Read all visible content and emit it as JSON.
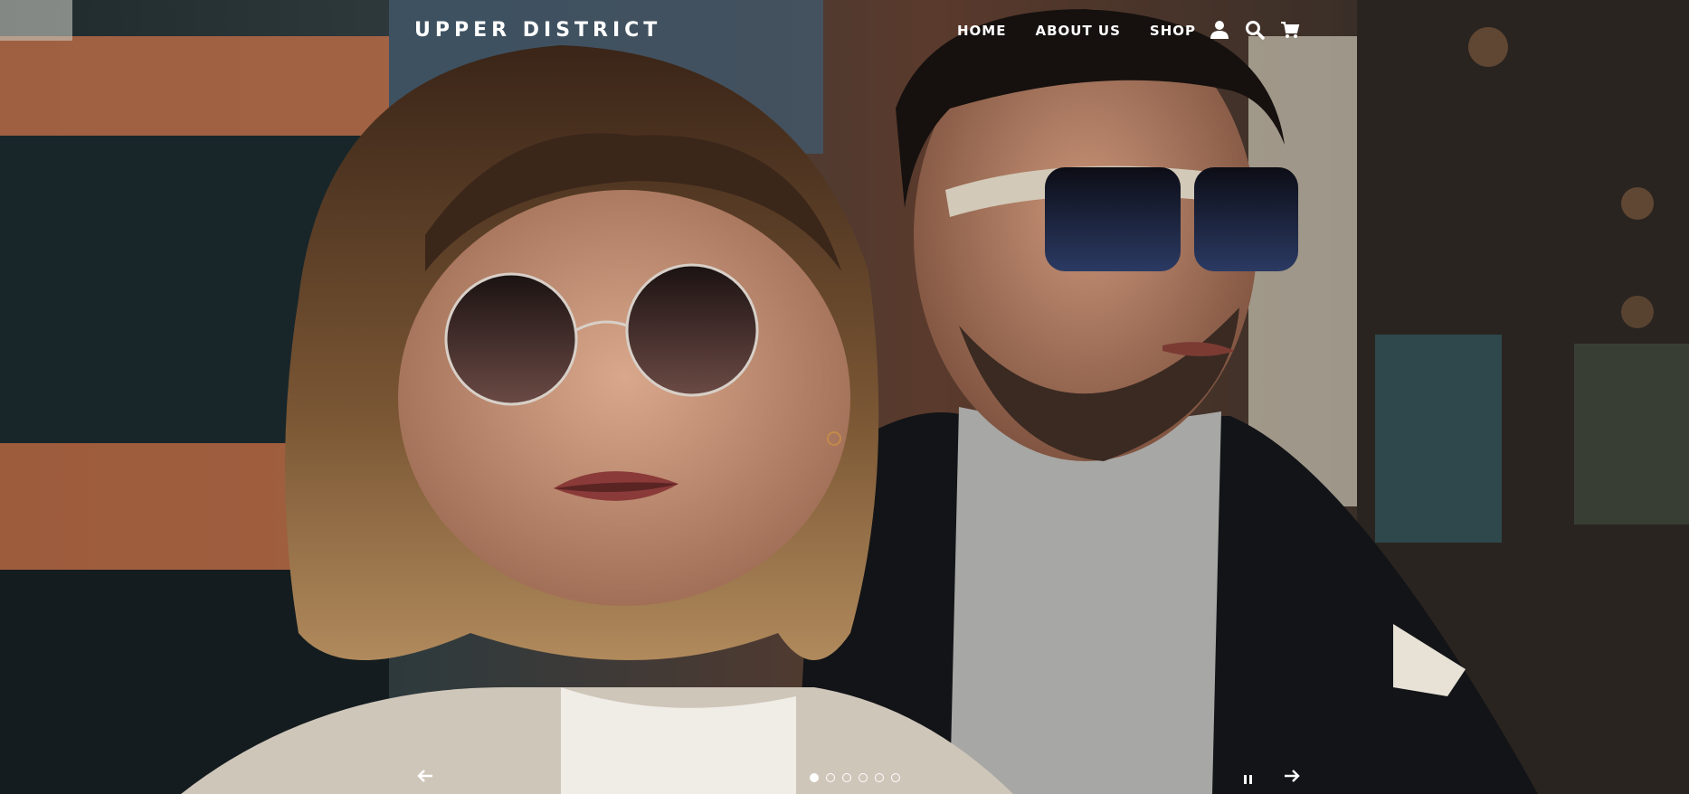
{
  "header": {
    "logo": "UPPER DISTRICT",
    "nav": [
      {
        "label": "HOME"
      },
      {
        "label": "ABOUT US"
      },
      {
        "label": "SHOP"
      }
    ],
    "icons": [
      "account-icon",
      "search-icon",
      "cart-icon"
    ]
  },
  "slideshow": {
    "slide_count": 6,
    "active_index": 0,
    "controls": [
      "previous-arrow-icon",
      "pause-icon",
      "next-arrow-icon"
    ]
  },
  "colors": {
    "text": "#ffffff"
  }
}
